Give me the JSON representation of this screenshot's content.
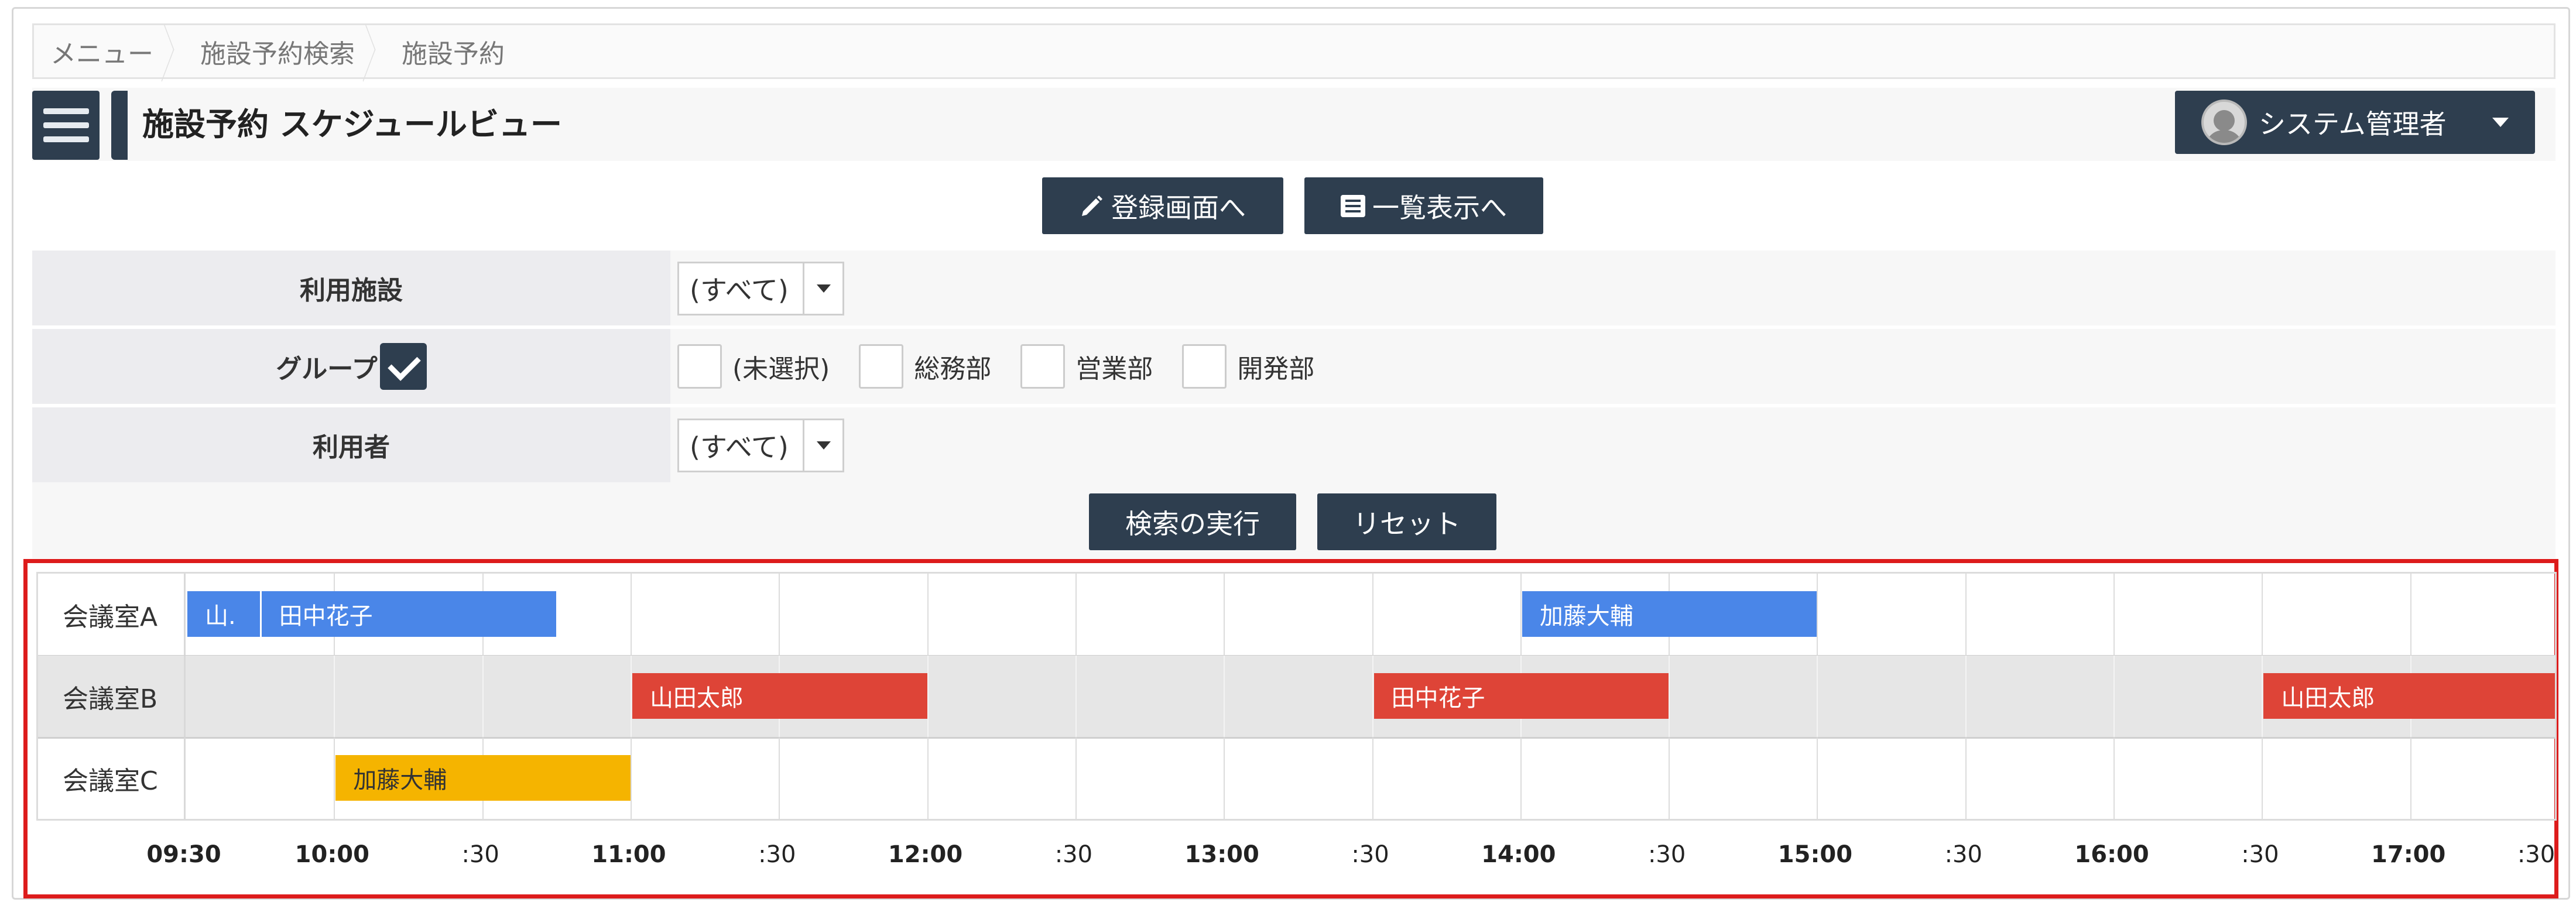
{
  "breadcrumb": [
    "メニュー",
    "施設予約検索",
    "施設予約"
  ],
  "header": {
    "title": "施設予約 スケジュールビュー",
    "user": "システム管理者",
    "avatar_icon": "user-avatar-icon",
    "menu_icon": "hamburger-icon"
  },
  "actions": {
    "register": "登録画面へ",
    "register_icon": "pencil-icon",
    "list": "一覧表示へ",
    "list_icon": "list-icon"
  },
  "filters": {
    "facility": {
      "label": "利用施設",
      "value": "(すべて)"
    },
    "group": {
      "label": "グループ",
      "checked": true,
      "options": [
        "(未選択)",
        "総務部",
        "営業部",
        "開発部"
      ]
    },
    "user": {
      "label": "利用者",
      "value": "(すべて)"
    }
  },
  "search": {
    "execute": "検索の実行",
    "reset": "リセット"
  },
  "schedule": {
    "timeline_start": "09:30",
    "timeline_end": "17:30",
    "rooms": [
      {
        "name": "会議室A",
        "shaded": false,
        "events": [
          {
            "label": "山.",
            "start": "09:30",
            "end": "09:45",
            "color": "#4a86e8"
          },
          {
            "label": "田中花子",
            "start": "09:45",
            "end": "10:45",
            "color": "#4a86e8"
          },
          {
            "label": "加藤大輔",
            "start": "14:00",
            "end": "15:00",
            "color": "#4a86e8"
          }
        ]
      },
      {
        "name": "会議室B",
        "shaded": true,
        "events": [
          {
            "label": "山田太郎",
            "start": "11:00",
            "end": "12:00",
            "color": "#de4437"
          },
          {
            "label": "田中花子",
            "start": "13:30",
            "end": "14:30",
            "color": "#de4437"
          },
          {
            "label": "山田太郎",
            "start": "16:30",
            "end": "17:30",
            "color": "#de4437"
          }
        ]
      },
      {
        "name": "会議室C",
        "shaded": false,
        "events": [
          {
            "label": "加藤大輔",
            "start": "10:00",
            "end": "11:00",
            "color": "#f5b400"
          }
        ]
      }
    ],
    "ticks": [
      "09:30",
      "10:00",
      ":30",
      "11:00",
      ":30",
      "12:00",
      ":30",
      "13:00",
      ":30",
      "14:00",
      ":30",
      "15:00",
      ":30",
      "16:00",
      ":30",
      "17:00",
      ":30"
    ]
  }
}
